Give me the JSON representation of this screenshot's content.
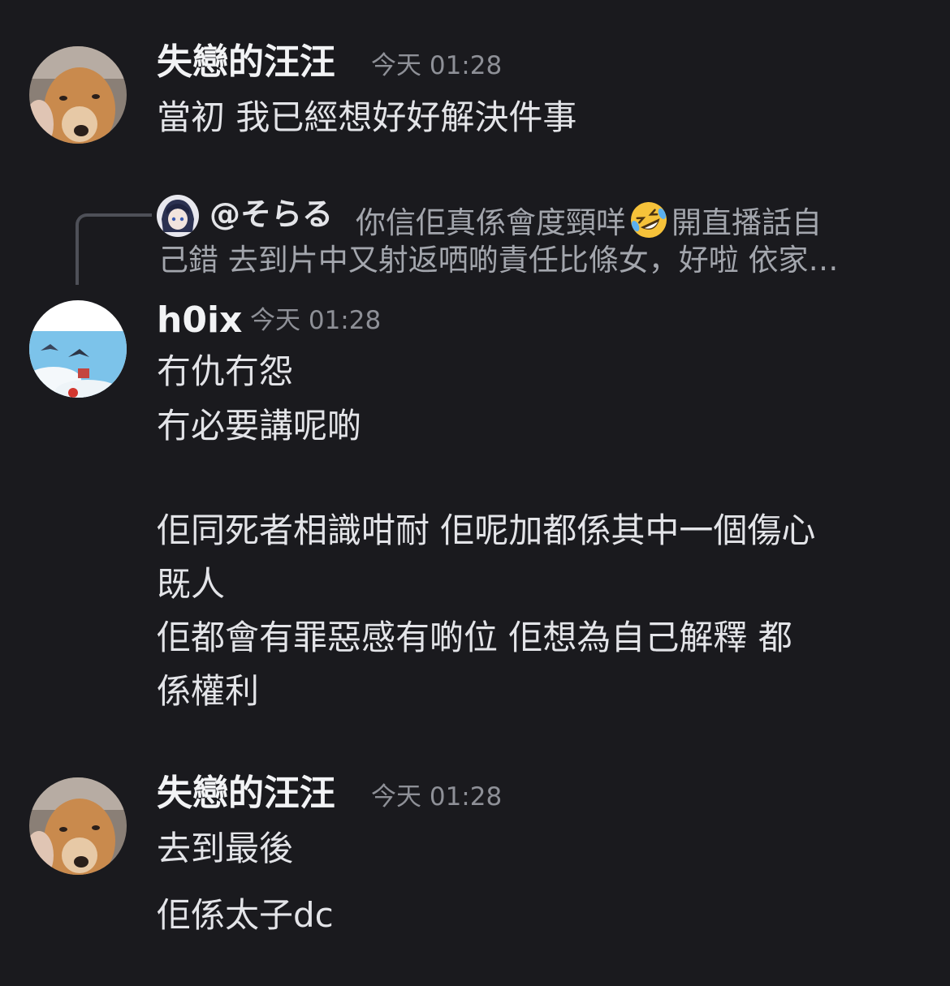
{
  "messages": [
    {
      "author": "失戀的汪汪",
      "time": "今天 01:28",
      "lines": [
        "當初 我已經想好好解決件事"
      ]
    },
    {
      "reply": {
        "user": "@そらる",
        "text_before_emoji": "你信佢真係會度頸咩",
        "emoji": "rolling-on-floor-laughing-emoji",
        "text_after_emoji": "開直播話自",
        "text_line2": "己錯 去到片中又射返哂啲責任比條女，好啦 依家…"
      },
      "author": "h0ix",
      "time": "今天 01:28",
      "lines": [
        "冇仇冇怨",
        "冇必要講呢啲",
        "佢同死者相識咁耐  佢呢加都係其中一個傷心",
        "既人",
        "佢都會有罪惡感有啲位 佢想為自己解釋  都",
        "係權利"
      ]
    },
    {
      "author": "失戀的汪汪",
      "time": "今天 01:28",
      "lines": [
        "去到最後",
        "佢係太子dc"
      ]
    }
  ],
  "colors": {
    "background": "#1a1a1e",
    "author": "#f2f3f5",
    "timestamp": "#8e9097",
    "message": "#e3e4e8",
    "reply_text": "#a3a6ad"
  }
}
